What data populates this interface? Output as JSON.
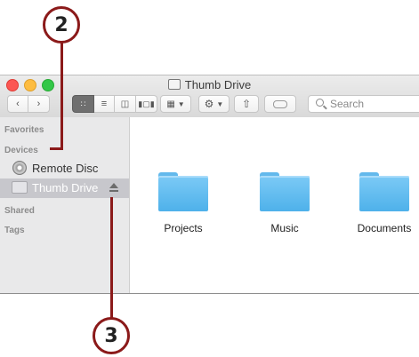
{
  "callouts": {
    "devices_number": "2",
    "eject_number": "3"
  },
  "colors": {
    "callout": "#8b1a1a",
    "folder": "#5ab8ee",
    "selection": "#c7c7cc"
  },
  "window": {
    "title": "Thumb Drive",
    "search_placeholder": "Search",
    "toolbar_icons": [
      "back-icon",
      "forward-icon",
      "icon-view-icon",
      "list-view-icon",
      "column-view-icon",
      "cover-flow-icon",
      "arrange-icon",
      "action-gear-icon",
      "share-icon",
      "tag-icon"
    ]
  },
  "sidebar": {
    "favorites": "Favorites",
    "devices": "Devices",
    "shared": "Shared",
    "tags": "Tags",
    "items": [
      {
        "label": "Remote Disc",
        "icon": "disc-icon",
        "selected": false
      },
      {
        "label": "Thumb Drive",
        "icon": "drive-icon",
        "selected": true
      }
    ]
  },
  "content": {
    "folders": [
      {
        "label": "Projects"
      },
      {
        "label": "Music"
      },
      {
        "label": "Documents"
      }
    ]
  }
}
